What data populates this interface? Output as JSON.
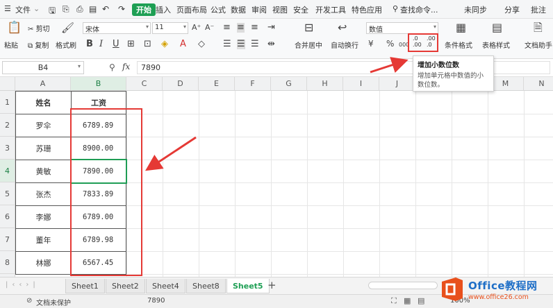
{
  "menubar": {
    "file": "文件",
    "tabs": [
      "开始",
      "插入",
      "页面布局",
      "公式",
      "数据",
      "审阅",
      "视图",
      "安全",
      "开发工具",
      "特色应用"
    ],
    "active_tab": "开始",
    "search": "查找命令...",
    "sync": "未同步",
    "share": "分享",
    "comment": "批注"
  },
  "ribbon": {
    "paste": "粘贴",
    "cut": "剪切",
    "copy": "复制",
    "format_painter": "格式刷",
    "font_name": "宋体",
    "font_size": "11",
    "merge_center": "合并居中",
    "wrap_text": "自动换行",
    "number_format": "数值",
    "conditional_format": "条件格式",
    "table_style": "表格样式",
    "doc_helper": "文档助手",
    "increase_decimal_glyph": ".0\n.00",
    "decrease_decimal_glyph": ".00\n.0"
  },
  "tooltip": {
    "title": "增加小数位数",
    "body": "增加单元格中数值的小数位数。"
  },
  "formula_bar": {
    "name_box": "B4",
    "fx": "fx",
    "value": "7890"
  },
  "columns": [
    "A",
    "B",
    "C",
    "D",
    "E",
    "F",
    "G",
    "H",
    "I",
    "J",
    "K",
    "L",
    "M",
    "N"
  ],
  "rows": [
    "1",
    "2",
    "3",
    "4",
    "5",
    "6",
    "7",
    "8",
    "9"
  ],
  "table": {
    "header": [
      "姓名",
      "工资"
    ],
    "data": [
      [
        "罗伞",
        "6789.89"
      ],
      [
        "苏珊",
        "8900.00"
      ],
      [
        "黄敏",
        "7890.00"
      ],
      [
        "张杰",
        "7833.89"
      ],
      [
        "李娜",
        "6789.00"
      ],
      [
        "董年",
        "6789.98"
      ],
      [
        "林娜",
        "6567.45"
      ]
    ]
  },
  "sheets": [
    "Sheet1",
    "Sheet2",
    "Sheet4",
    "Sheet8",
    "Sheet5"
  ],
  "active_sheet": "Sheet5",
  "status": {
    "protect": "文档未保护",
    "value": "7890",
    "zoom": "100%"
  },
  "watermark": {
    "brand": "Office教程网",
    "url": "www.office26.com"
  },
  "colors": {
    "accent_green": "#1e9f54",
    "highlight_red": "#e53935"
  }
}
